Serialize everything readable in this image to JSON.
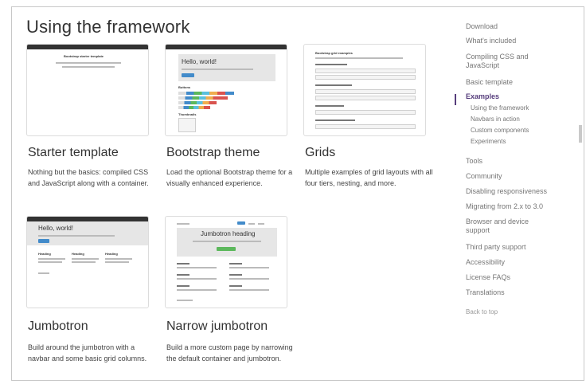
{
  "page": {
    "title": "Using the framework"
  },
  "cards": [
    {
      "title": "Starter template",
      "description": "Nothing but the basics: compiled CSS and JavaScript along with a container.",
      "thumb_text": "Bootstrap starter template"
    },
    {
      "title": "Bootstrap theme",
      "description": "Load the optional Bootstrap theme for a visually enhanced experience.",
      "thumb_text": "Hello, world!",
      "thumb_sub1": "Buttons",
      "thumb_sub2": "Thumbnails"
    },
    {
      "title": "Grids",
      "description": "Multiple examples of grid layouts with all four tiers, nesting, and more.",
      "thumb_text": "Bootstrap grid examples"
    },
    {
      "title": "Jumbotron",
      "description": "Build around the jumbotron with a navbar and some basic grid columns.",
      "thumb_text": "Hello, world!",
      "thumb_cols": [
        "Heading",
        "Heading",
        "Heading"
      ]
    },
    {
      "title": "Narrow jumbotron",
      "description": "Build a more custom page by narrowing the default container and jumbotron.",
      "thumb_text": "Jumbotron heading"
    }
  ],
  "sidebar": {
    "items": [
      "Download",
      "What's included",
      "Compiling CSS and JavaScript",
      "Basic template",
      "Examples"
    ],
    "subitems": [
      "Using the framework",
      "Navbars in action",
      "Custom components",
      "Experiments"
    ],
    "items2": [
      "Tools",
      "Community",
      "Disabling responsiveness",
      "Migrating from 2.x to 3.0",
      "Browser and device support",
      "Third party support",
      "Accessibility",
      "License FAQs",
      "Translations"
    ],
    "back_to_top": "Back to top"
  },
  "colors": {
    "accent": "#563d7c",
    "primary_button": "#428bca",
    "success_button": "#5cb85c"
  }
}
